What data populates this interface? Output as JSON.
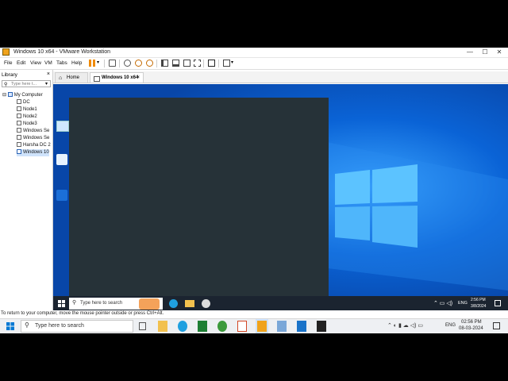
{
  "window": {
    "title": "Windows 10 x64 - VMware Workstation",
    "controls": {
      "minimize": "—",
      "maximize": "☐",
      "close": "✕"
    }
  },
  "menubar": {
    "items": [
      "File",
      "Edit",
      "View",
      "VM",
      "Tabs",
      "Help"
    ]
  },
  "library": {
    "title": "Library",
    "close": "×",
    "search_placeholder": "Type here t...",
    "tree": [
      "My Computer",
      "DC",
      "Node1",
      "Node2",
      "Node3",
      "Windows Se",
      "Windows Se",
      "Harsha DC 2",
      "Windows 10"
    ]
  },
  "tabs": [
    {
      "label": "Home",
      "active": false,
      "close": ""
    },
    {
      "label": "Windows 10 x64",
      "active": true,
      "close": "×"
    }
  ],
  "guest": {
    "taskbar": {
      "search_placeholder": "Type here to search",
      "clock_time": "2:56 PM",
      "clock_date": "3/8/2024",
      "lang": "ENG"
    }
  },
  "status_hint": "To return to your computer, move the mouse pointer outside or press Ctrl+Alt.",
  "host_taskbar": {
    "search_placeholder": "Type here to search",
    "lang": "ENG",
    "clock_time": "02:56 PM",
    "clock_date": "08-03-2024"
  },
  "colors": {
    "guest_wallpaper": "#0b5bc7",
    "dark_window": "#263238",
    "vmware_accent": "#f0a31c"
  }
}
